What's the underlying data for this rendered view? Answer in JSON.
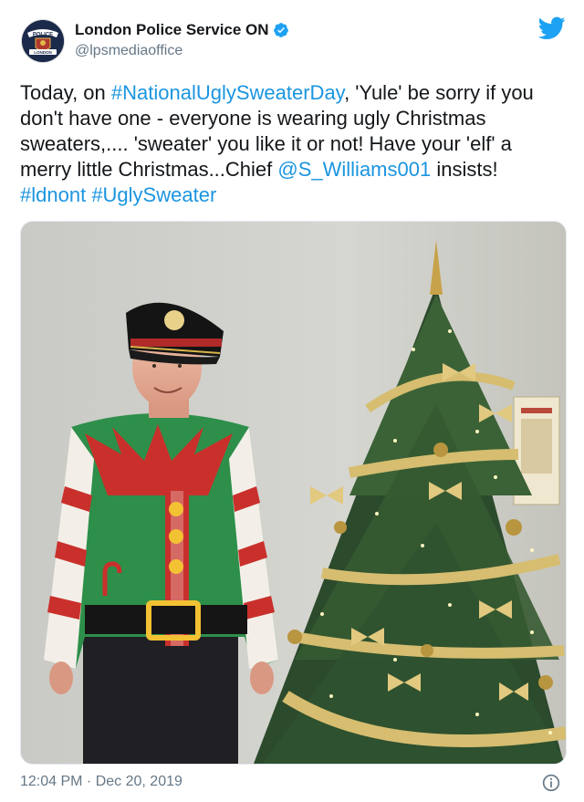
{
  "tweet": {
    "author_name": "London Police Service ON",
    "handle": "@lpsmediaoffice",
    "text_segments": [
      {
        "text": "Today, on ",
        "type": "plain"
      },
      {
        "text": "#NationalUglySweaterDay",
        "type": "link"
      },
      {
        "text": ", 'Yule' be sorry if you don't have one - everyone is wearing ugly Christmas sweaters,.... 'sweater' you like it or not!  Have your 'elf' a merry little Christmas...Chief ",
        "type": "plain"
      },
      {
        "text": "@S_Williams001",
        "type": "link"
      },
      {
        "text": " insists! ",
        "type": "plain"
      },
      {
        "text": "#ldnont",
        "type": "link"
      },
      {
        "text": " ",
        "type": "plain"
      },
      {
        "text": "#UglySweater",
        "type": "link"
      }
    ],
    "timestamp": "12:04 PM · Dec 20, 2019",
    "avatar_badge_text": "POLICE",
    "avatar_badge_subtext": "LONDON"
  },
  "icons": {
    "verified": "verified-badge-icon",
    "twitter": "twitter-bird-icon",
    "info": "info-icon"
  },
  "colors": {
    "link": "#1b95e0",
    "twitter_blue": "#1da1f2",
    "secondary_text": "#657786"
  }
}
